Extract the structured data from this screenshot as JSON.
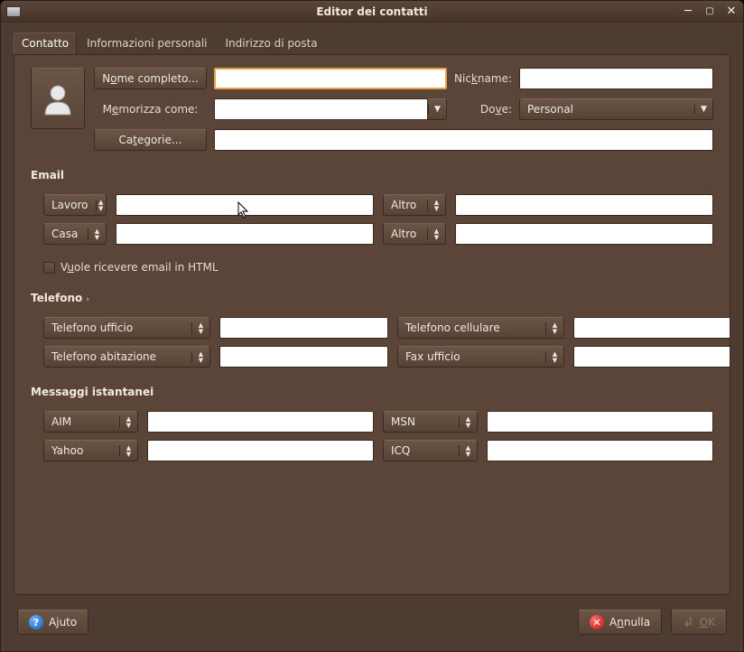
{
  "window": {
    "title": "Editor dei contatti"
  },
  "tabs": {
    "contact": "Contatto",
    "personal": "Informazioni personali",
    "mail": "Indirizzo di posta"
  },
  "identity": {
    "fullname_btn_pre": "N",
    "fullname_btn_u": "o",
    "fullname_btn_post": "me completo...",
    "nickname_label_pre": "Nic",
    "nickname_label_u": "k",
    "nickname_label_post": "name:",
    "fileas_label_pre": "M",
    "fileas_label_u": "e",
    "fileas_label_post": "morizza come:",
    "where_label_pre": "Do",
    "where_label_u": "v",
    "where_label_post": "e:",
    "where_value": "Personal",
    "categories_btn_pre": "Ca",
    "categories_btn_u": "t",
    "categories_btn_post": "egorie...",
    "fullname_value": "",
    "nickname_value": "",
    "fileas_value": "",
    "categories_value": ""
  },
  "email": {
    "title": "Email",
    "types": [
      "Lavoro",
      "Altro",
      "Casa",
      "Altro"
    ],
    "values": [
      "",
      "",
      "",
      ""
    ],
    "html_checkbox_pre": "V",
    "html_checkbox_u": "u",
    "html_checkbox_post": "ole ricevere email in HTML"
  },
  "phone": {
    "title": "Telefono",
    "types": [
      "Telefono ufficio",
      "Telefono cellulare",
      "Telefono abitazione",
      "Fax ufficio"
    ],
    "values": [
      "",
      "",
      "",
      ""
    ]
  },
  "im": {
    "title": "Messaggi istantanei",
    "types": [
      "AIM",
      "MSN",
      "Yahoo",
      "ICQ"
    ],
    "values": [
      "",
      "",
      "",
      ""
    ]
  },
  "footer": {
    "help_pre": "A",
    "help_u": "j",
    "help_post": "uto",
    "cancel_pre": "A",
    "cancel_u": "n",
    "cancel_post": "nulla",
    "ok_pre": "",
    "ok_u": "O",
    "ok_post": "K"
  }
}
